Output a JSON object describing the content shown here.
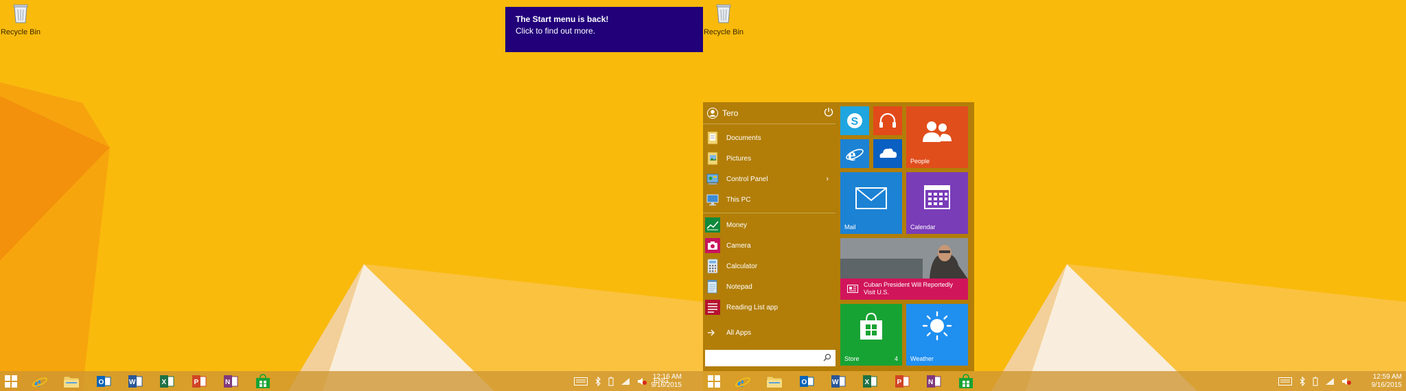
{
  "desktop": {
    "recycle_bin_label": "Recycle Bin"
  },
  "notification": {
    "title": "The Start menu is back!",
    "body": "Click to find out more."
  },
  "start_menu": {
    "user_name": "Tero",
    "places": [
      {
        "label": "Documents",
        "icon": "documents-folder-icon"
      },
      {
        "label": "Pictures",
        "icon": "pictures-folder-icon"
      },
      {
        "label": "Control Panel",
        "icon": "control-panel-icon"
      },
      {
        "label": "This PC",
        "icon": "this-pc-icon"
      }
    ],
    "apps": [
      {
        "label": "Money",
        "icon": "money-icon"
      },
      {
        "label": "Camera",
        "icon": "camera-icon"
      },
      {
        "label": "Calculator",
        "icon": "calculator-icon"
      },
      {
        "label": "Notepad",
        "icon": "notepad-icon"
      },
      {
        "label": "Reading List app",
        "icon": "reading-list-icon"
      }
    ],
    "all_apps_label": "All Apps",
    "search_value": "",
    "tiles": {
      "people": "People",
      "mail": "Mail",
      "calendar": "Calendar",
      "news_headline": "Cuban President Will Reportedly Visit U.S.",
      "store": "Store",
      "store_badge": "4",
      "weather": "Weather"
    }
  },
  "taskbar": {
    "apps": [
      "internet-explorer",
      "file-explorer",
      "outlook",
      "word",
      "excel",
      "powerpoint",
      "onenote",
      "store"
    ],
    "language": "ENG"
  },
  "clocks": {
    "left": {
      "time": "12:16 AM",
      "date": "9/16/2015"
    },
    "right": {
      "time": "12:59 AM",
      "date": "9/16/2015"
    }
  },
  "colors": {
    "wallpaper": "#f8b80a",
    "start_menu_bg": "#b27e08",
    "toast_bg": "#21007a",
    "tile_skype": "#1fa5e0",
    "tile_music": "#e24a1a",
    "tile_people": "#e04e1c",
    "tile_mail": "#1c82d4",
    "tile_calendar": "#7a3db8",
    "tile_store": "#17a334",
    "tile_weather": "#1f8ff0",
    "news_banner": "#d1155a"
  }
}
